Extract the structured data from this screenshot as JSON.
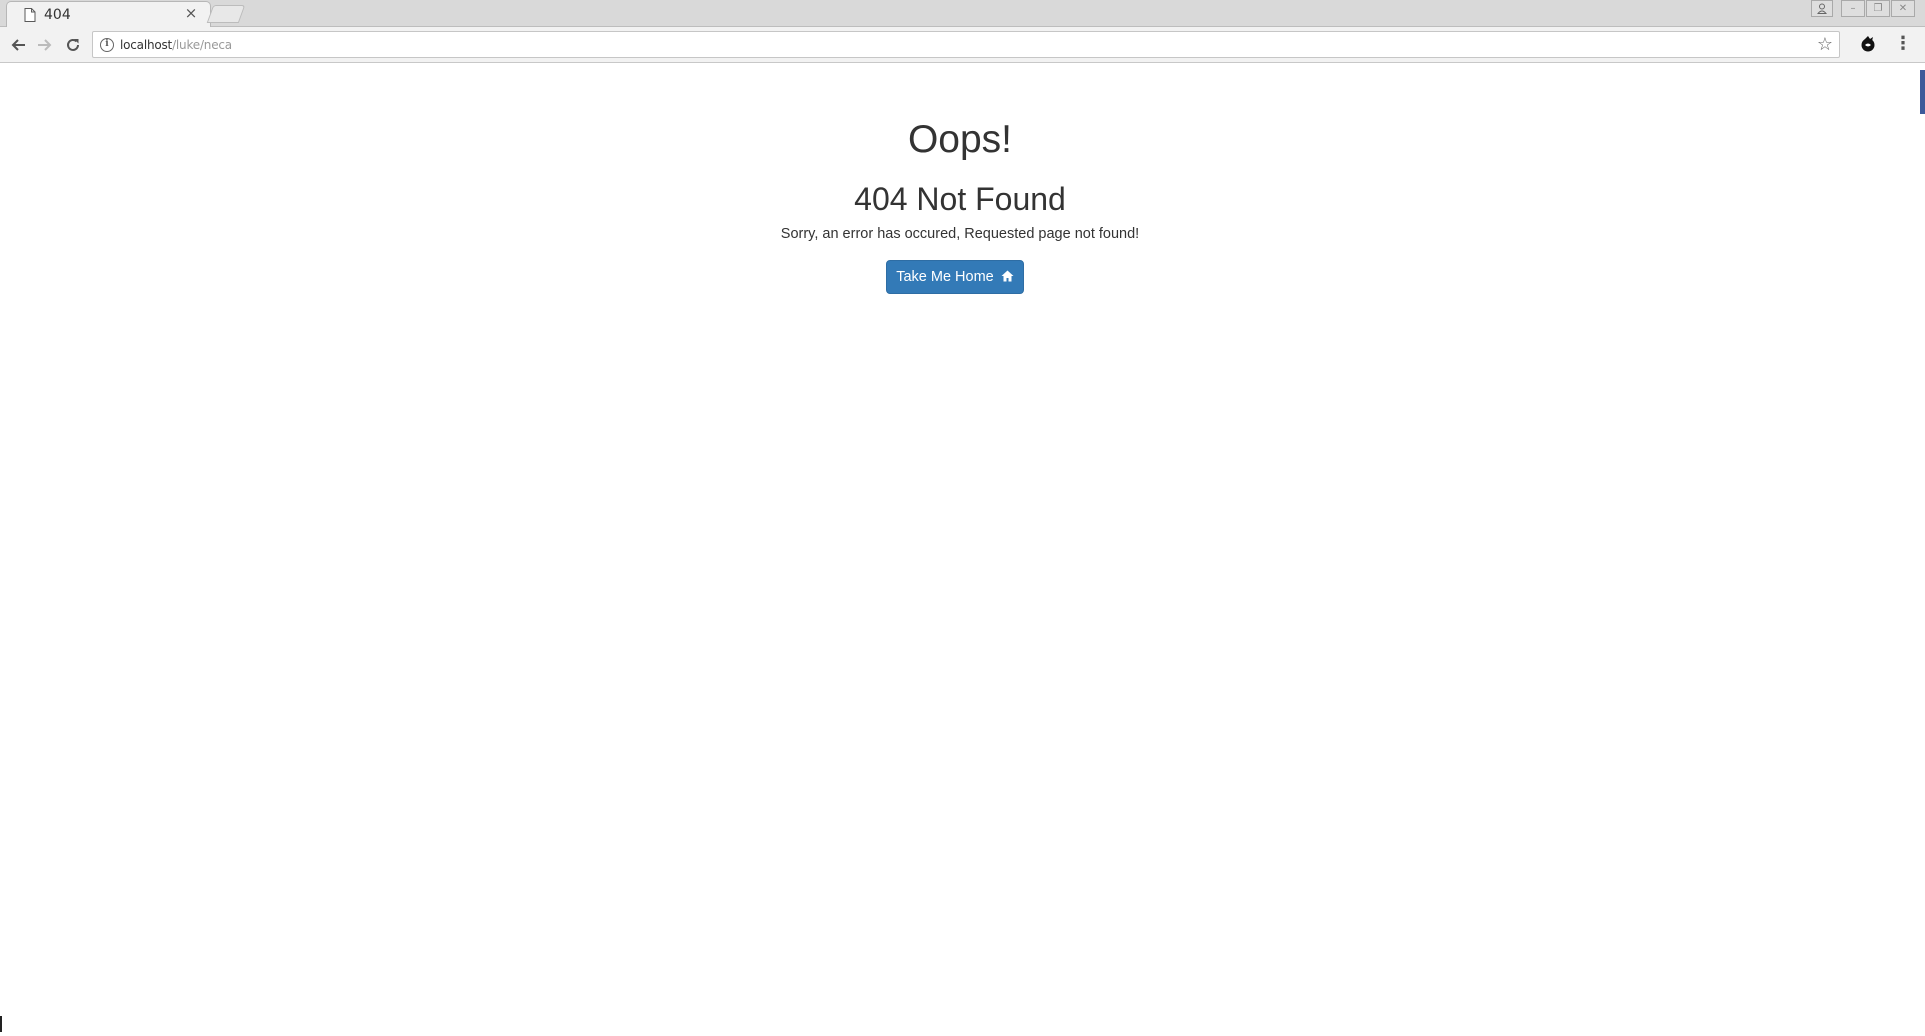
{
  "browser": {
    "tab": {
      "title": "404",
      "icon": "page-icon",
      "close_icon": "close-icon"
    },
    "address_bar": {
      "host": "localhost",
      "path": "/luke/neca",
      "icon": "info-icon"
    },
    "nav": {
      "back_icon": "back-arrow-icon",
      "forward_icon": "forward-arrow-icon",
      "reload_icon": "reload-icon",
      "back_enabled": true,
      "forward_enabled": false
    },
    "toolbar_icons": [
      "star-icon",
      "extension-icon",
      "menu-icon"
    ],
    "window_controls": [
      "profile-icon",
      "minimize-icon",
      "restore-icon",
      "close-window-icon"
    ]
  },
  "page": {
    "heading": "Oops!",
    "subheading": "404 Not Found",
    "message": "Sorry, an error has occured, Requested page not found!",
    "button": {
      "label": "Take Me Home",
      "icon": "home-icon",
      "color": "#337ab7"
    }
  }
}
